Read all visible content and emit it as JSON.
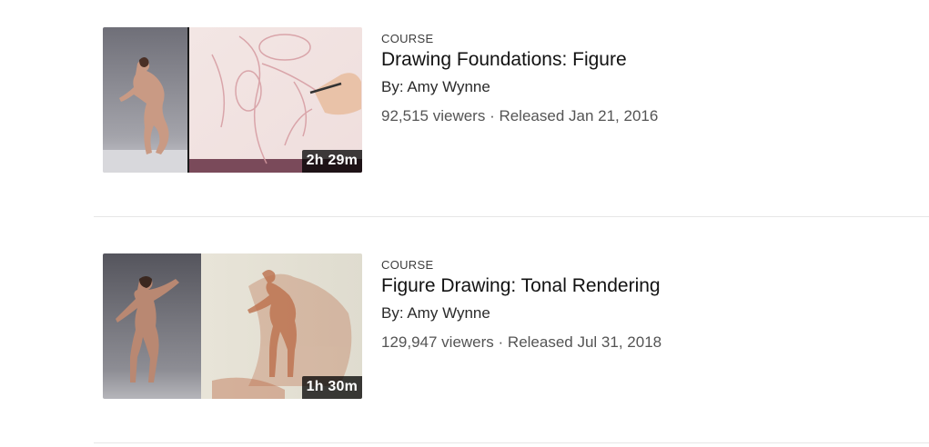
{
  "courses": [
    {
      "type": "COURSE",
      "title": "Drawing Foundations: Figure",
      "author": "By: Amy Wynne",
      "viewers": "92,515 viewers",
      "separator": " · ",
      "released": "Released Jan 21, 2016",
      "duration": "2h 29m"
    },
    {
      "type": "COURSE",
      "title": "Figure Drawing: Tonal Rendering",
      "author": "By: Amy Wynne",
      "viewers": "129,947 viewers",
      "separator": " · ",
      "released": "Released Jul 31, 2018",
      "duration": "1h 30m"
    }
  ],
  "colors": {
    "duration_badge_bg": "#000000",
    "divider": "#e6e6e6",
    "title": "#121212",
    "stats": "#545454"
  }
}
